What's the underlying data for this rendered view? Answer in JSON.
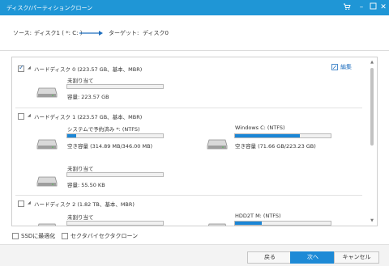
{
  "window": {
    "title": "ディスク/パーティションクローン"
  },
  "path": {
    "source_label": "ソース:",
    "source_value": "ディスク1 ( *: C: )",
    "target_label": "ターゲット:",
    "target_value": "ディスク0"
  },
  "disks": [
    {
      "header": "ハードディスク 0 (223.57 GB、基本、MBR)",
      "checked": true,
      "edit_label": "編集",
      "partitions": [
        {
          "name": "未割り当て",
          "capacity": "容量: 223.57 GB",
          "used_fraction": 0
        }
      ]
    },
    {
      "header": "ハードディスク 1 (223.57 GB、基本、MBR)",
      "checked": false,
      "partitions": [
        {
          "name": "システムで予約済み *: (NTFS)",
          "capacity": "空き容量 (314.89 MB/346.00 MB)",
          "used_fraction": 0.09
        },
        {
          "name": "Windows C: (NTFS)",
          "capacity": "空き容量 (71.66 GB/223.23 GB)",
          "used_fraction": 0.68
        },
        {
          "name": "未割り当て",
          "capacity": "容量: 55.50 KB",
          "used_fraction": 0
        }
      ]
    },
    {
      "header": "ハードディスク 2 (1.82 TB、基本、MBR)",
      "checked": false,
      "partitions": [
        {
          "name": "未割り当て",
          "capacity": "",
          "used_fraction": 0
        },
        {
          "name": "HDD2T M: (NTFS)",
          "capacity": "",
          "used_fraction": 0.28
        }
      ]
    }
  ],
  "options": {
    "ssd_optimize": "SSDに最適化",
    "sector_by_sector": "セクタバイセクタクローン"
  },
  "buttons": {
    "back": "戻る",
    "next": "次へ",
    "cancel": "キャンセル"
  },
  "colors": {
    "accent": "#1f96d6",
    "bar_fill": "#1b86d6",
    "primary_button": "#1e8ad6"
  }
}
